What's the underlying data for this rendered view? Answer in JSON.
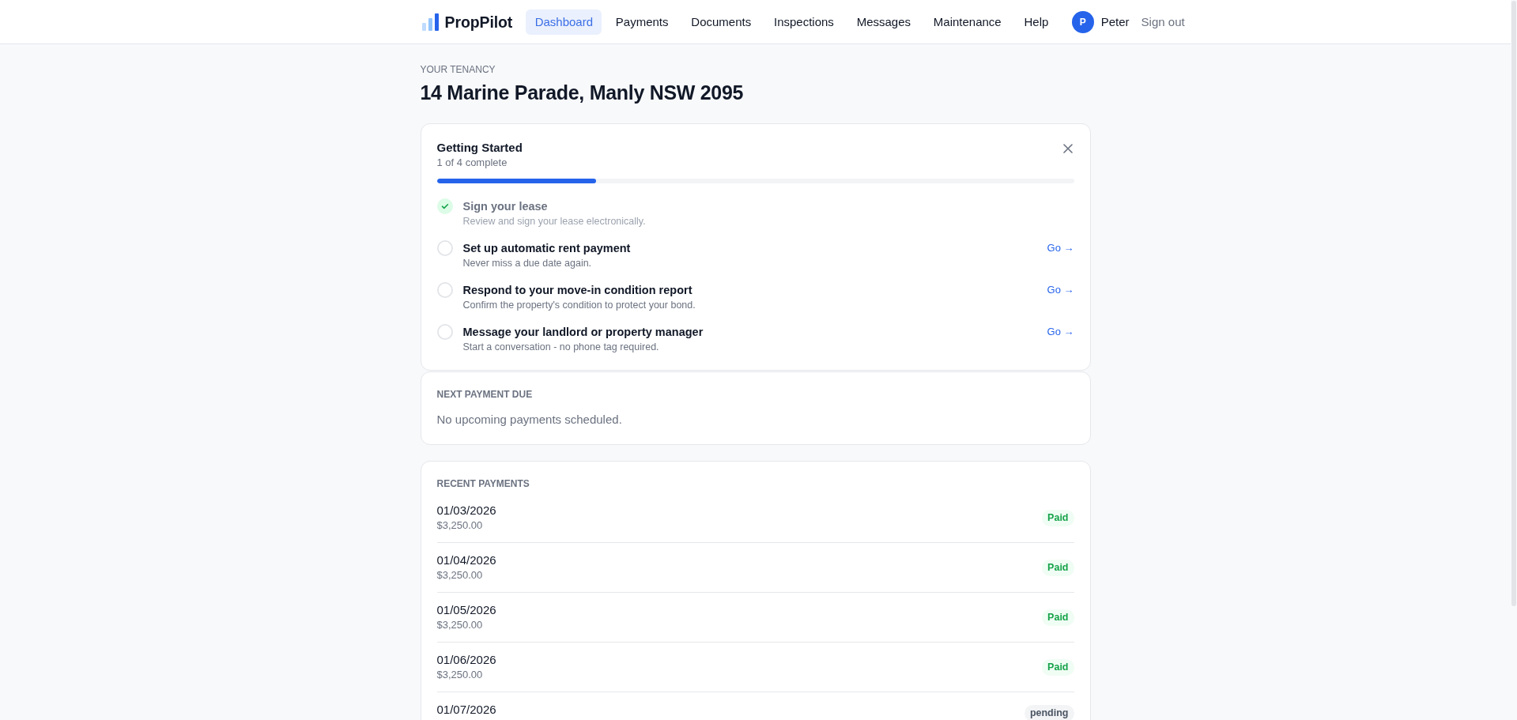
{
  "navbar": {
    "brand": "PropPilot",
    "links": [
      {
        "label": "Dashboard",
        "selected": true
      },
      {
        "label": "Payments",
        "selected": false
      },
      {
        "label": "Documents",
        "selected": false
      },
      {
        "label": "Inspections",
        "selected": false
      },
      {
        "label": "Messages",
        "selected": false
      },
      {
        "label": "Maintenance",
        "selected": false
      },
      {
        "label": "Help",
        "selected": false
      }
    ],
    "user": {
      "initial": "P",
      "name": "Peter"
    },
    "sign_out": "Sign out"
  },
  "tenancy": {
    "eyebrow": "YOUR TENANCY",
    "address": "14 Marine Parade, Manly NSW 2095"
  },
  "getting_started": {
    "title": "Getting Started",
    "progress_text": "1 of 4 complete",
    "level": 0.25,
    "steps": [
      {
        "title": "Sign your lease",
        "description": "Review and sign your lease electronically.",
        "completed": true
      },
      {
        "title": "Set up automatic rent payment",
        "description": "Never miss a due date again.",
        "completed": false,
        "action": "Go →"
      },
      {
        "title": "Respond to your move-in condition report",
        "description": "Confirm the property's condition to protect your bond.",
        "completed": false,
        "action": "Go →"
      },
      {
        "title": "Message your landlord or property manager",
        "description": "Start a conversation - no phone tag required.",
        "completed": false,
        "action": "Go →"
      }
    ]
  },
  "next_payment": {
    "heading": "NEXT PAYMENT DUE",
    "message": "No upcoming payments scheduled."
  },
  "recent_payments": {
    "heading": "RECENT PAYMENTS",
    "rows": [
      {
        "date": "01/03/2026",
        "amount": "$3,250.00",
        "status": "Paid",
        "kind": "paid"
      },
      {
        "date": "01/04/2026",
        "amount": "$3,250.00",
        "status": "Paid",
        "kind": "paid"
      },
      {
        "date": "01/05/2026",
        "amount": "$3,250.00",
        "status": "Paid",
        "kind": "paid"
      },
      {
        "date": "01/06/2026",
        "amount": "$3,250.00",
        "status": "Paid",
        "kind": "paid"
      },
      {
        "date": "01/07/2026",
        "status": "pending",
        "kind": "pending"
      }
    ]
  }
}
